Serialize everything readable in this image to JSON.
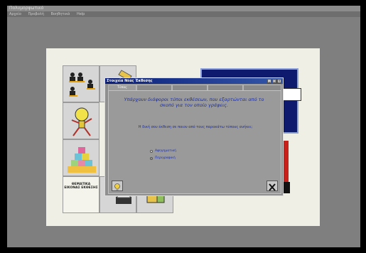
{
  "window": {
    "title": "Πολυμορφωτικό",
    "menu": [
      "Αρχείο",
      "Προβολή",
      "Βοηθητικά",
      "Help"
    ]
  },
  "dialog": {
    "title": "Στοιχεία Νέας Έκθεσης",
    "tabs": [
      "Τύπος",
      "",
      "",
      "",
      ""
    ],
    "heading": "Υπάρχουν διάφοροι τύποι εκθέσεων, που εξαρτώνται από το σκοπό για τον οποίο γράφεις.",
    "question": "Η δική σου έκθεση σε ποιον από τους παρακάτω τύπους ανήκει;",
    "options": [
      {
        "label": "Αφηγηματική",
        "selected": false
      },
      {
        "label": "Περιγραφική",
        "selected": true
      }
    ],
    "window_buttons": [
      "_",
      "□",
      "×"
    ]
  },
  "tiles": {
    "label_tile": "ΘΕΜΑΤΙΚΑ ΕΙΚΟΝΑΣ ΕΚΘΕΣΗΣ"
  },
  "colors": {
    "desktop": "#7f7f7f",
    "canvas": "#efefe6",
    "dialog_title": "#0b1f7a",
    "dialog_text": "#1a2fb0",
    "blue_panel": "#0d1a6e",
    "red_panel": "#c8201b"
  },
  "icons": [
    "people-icon",
    "lightbulb-mascot-icon",
    "stacked-blocks-icon",
    "help-lightbulb-icon",
    "close-x-icon"
  ]
}
